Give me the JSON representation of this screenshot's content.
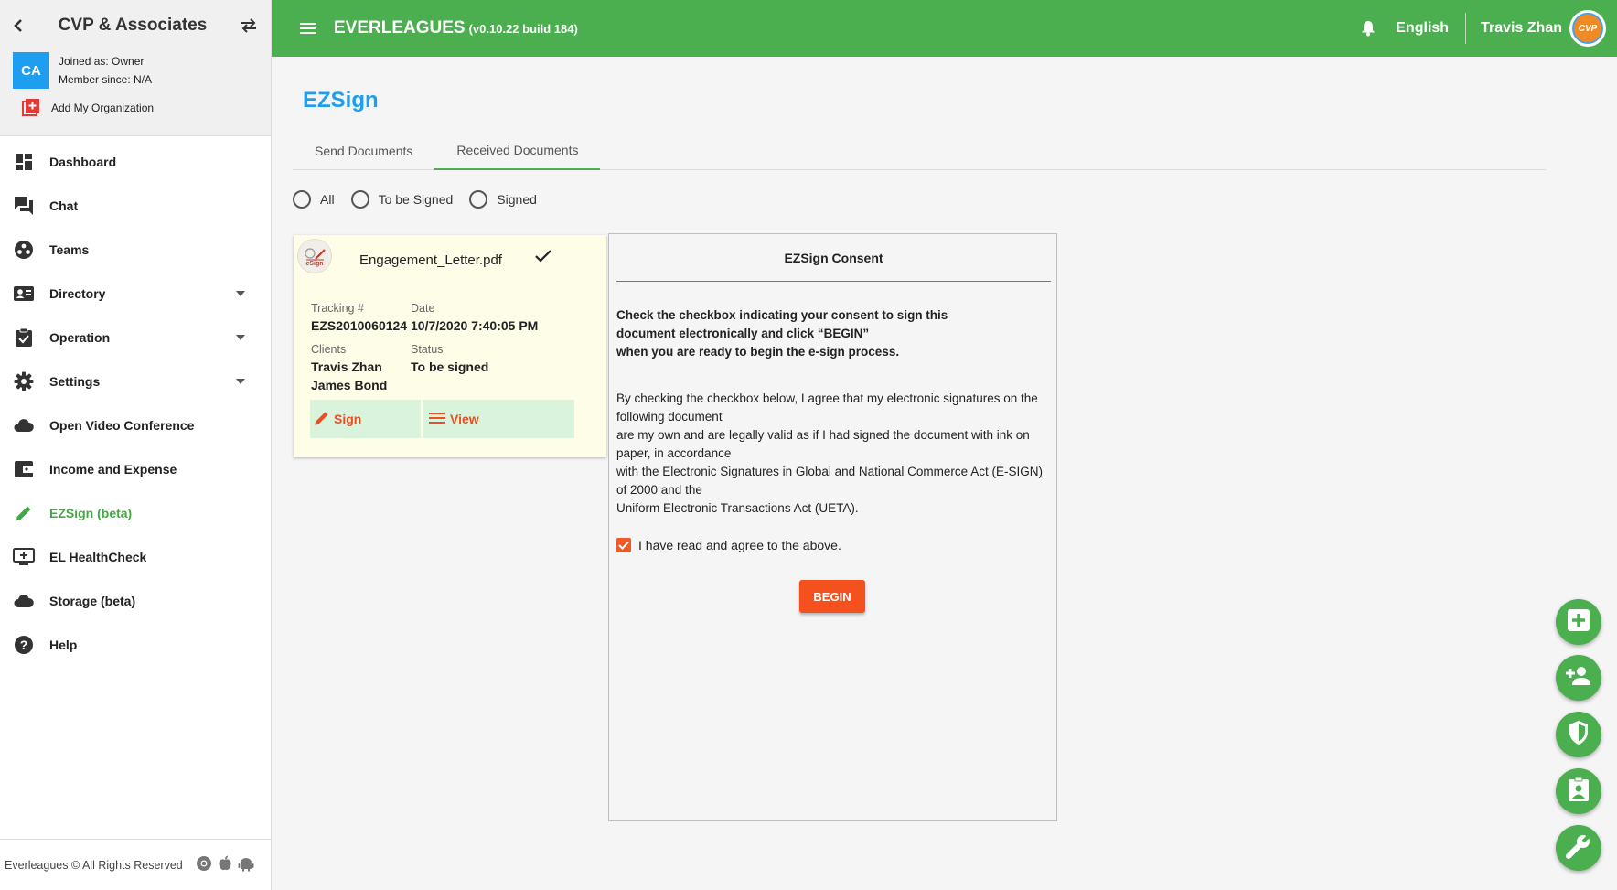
{
  "sidebar": {
    "org_name": "CVP & Associates",
    "org_initials": "CA",
    "joined_as": "Joined as: Owner",
    "member_since": "Member since: N/A",
    "add_org": "Add My Organization",
    "items": [
      {
        "label": "Dashboard",
        "icon": "dashboard-icon"
      },
      {
        "label": "Chat",
        "icon": "chat-icon"
      },
      {
        "label": "Teams",
        "icon": "teams-icon"
      },
      {
        "label": "Directory",
        "icon": "contact-card-icon",
        "has_dropdown": true
      },
      {
        "label": "Operation",
        "icon": "clipboard-check-icon",
        "has_dropdown": true
      },
      {
        "label": "Settings",
        "icon": "gear-icon",
        "has_dropdown": true
      },
      {
        "label": "Open Video Conference",
        "icon": "cloud-icon"
      },
      {
        "label": "Income and Expense",
        "icon": "wallet-icon"
      },
      {
        "label": "EZSign (beta)",
        "icon": "pencil-icon",
        "active": true
      },
      {
        "label": "EL HealthCheck",
        "icon": "monitor-plus-icon"
      },
      {
        "label": "Storage (beta)",
        "icon": "cloud-storage-icon"
      },
      {
        "label": "Help",
        "icon": "help-icon"
      }
    ],
    "footer": "Everleagues © All Rights Reserved"
  },
  "topbar": {
    "app_name": "EVERLEAGUES",
    "version": "(v0.10.22 build 184)",
    "language": "English",
    "user_name": "Travis Zhan",
    "avatar_text": "CVP"
  },
  "main": {
    "title": "EZSign",
    "tabs": [
      {
        "label": "Send Documents",
        "active": false
      },
      {
        "label": "Received Documents",
        "active": true
      }
    ],
    "filters": [
      "All",
      "To be Signed",
      "Signed"
    ]
  },
  "document": {
    "logo_text": "eSign",
    "file_name": "Engagement_Letter.pdf",
    "tracking_label": "Tracking #",
    "tracking_value": "EZS2010060124",
    "date_label": "Date",
    "date_value": "10/7/2020 7:40:05 PM",
    "clients_label": "Clients",
    "clients": [
      "Travis Zhan",
      "James Bond"
    ],
    "status_label": "Status",
    "status_value": "To be signed",
    "sign_label": "Sign",
    "view_label": "View"
  },
  "consent": {
    "title": "EZSign Consent",
    "instruction_line1": "Check the checkbox indicating your consent to sign this document electronically and click “BEGIN”",
    "instruction_line2": "when you are ready to begin the e-sign process.",
    "body_lines": [
      "By checking the checkbox below, I agree that my electronic signatures on the following document",
      "are my own and are legally valid as if I had signed the document with ink on paper, in accordance",
      "with the Electronic Signatures in Global and National Commerce Act (E-SIGN) of 2000 and the",
      "Uniform Electronic Transactions Act (UETA)."
    ],
    "agree_label": "I have read and agree to the above.",
    "agree_checked": true,
    "begin_label": "BEGIN"
  },
  "fabs": [
    "add-icon",
    "add-person-icon",
    "shield-icon",
    "contact-badge-icon",
    "wrench-icon"
  ],
  "colors": {
    "primary_green": "#4bae4f",
    "accent_blue": "#1e9ef0",
    "action_orange": "#f4511e"
  }
}
